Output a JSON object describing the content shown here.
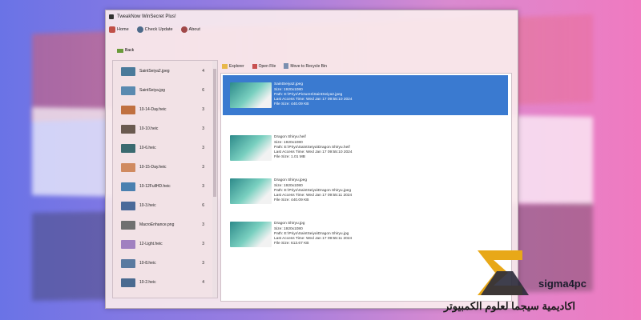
{
  "window": {
    "title": "TweakNow WinSecret Plus!"
  },
  "menu": [
    {
      "label": "Home",
      "icon": "home-icon"
    },
    {
      "label": "Check Update",
      "icon": "globe-icon"
    },
    {
      "label": "About",
      "icon": "info-icon"
    }
  ],
  "back_label": "Back",
  "sidebar": {
    "items": [
      {
        "name": "SaintSeiya2.jpeg",
        "count": "4",
        "thumb": "#4a7a9a"
      },
      {
        "name": "SaintSeiya.jpg",
        "count": "6",
        "thumb": "#5a8ab0"
      },
      {
        "name": "10-14-Day.heic",
        "count": "3",
        "thumb": "#c07040"
      },
      {
        "name": "10-10.heic",
        "count": "3",
        "thumb": "#6a5a50"
      },
      {
        "name": "10-6.heic",
        "count": "3",
        "thumb": "#3a6a70"
      },
      {
        "name": "10-15-Day.heic",
        "count": "3",
        "thumb": "#d08a60"
      },
      {
        "name": "10-12FullHD.heic",
        "count": "3",
        "thumb": "#4a80b0"
      },
      {
        "name": "10-3.heic",
        "count": "6",
        "thumb": "#4a6a9a"
      },
      {
        "name": "MacroEnhance.png",
        "count": "3",
        "thumb": "#707070"
      },
      {
        "name": "12-Light.heic",
        "count": "3",
        "thumb": "#a080c0"
      },
      {
        "name": "10-8.heic",
        "count": "3",
        "thumb": "#5a7aa0"
      },
      {
        "name": "10-2.heic",
        "count": "4",
        "thumb": "#4a6a90"
      }
    ]
  },
  "toolbar": [
    {
      "label": "Explorer",
      "icon": "folder-icon"
    },
    {
      "label": "Open File",
      "icon": "pen-icon"
    },
    {
      "label": "Move to Recycle Bin",
      "icon": "recycle-icon"
    }
  ],
  "files": [
    {
      "name": "SaintSeiya2.jpeg",
      "size": "Size: 1920x1080",
      "path": "Path: E:\\Priyo\\Pictures\\SaintSeiya2.jpeg",
      "access": "Last Access Time: Wed Jan 17 09:55:10 2024",
      "filesize": "File Size: 440.09 KB"
    },
    {
      "name": "Dragon Shiryu.heif",
      "size": "Size: 1920x1080",
      "path": "Path: E:\\Priyo\\SaintSeiya\\Dragon Shiryu.heif",
      "access": "Last Access Time: Wed Jan 17 09:55:10 2024",
      "filesize": "File Size: 1.01 MB"
    },
    {
      "name": "Dragon Shiryu.jpeg",
      "size": "Size: 1920x1080",
      "path": "Path: E:\\Priyo\\SaintSeiya\\Dragon Shiryu.jpeg",
      "access": "Last Access Time: Wed Jan 17 09:55:11 2024",
      "filesize": "File Size: 440.09 KB"
    },
    {
      "name": "Dragon Shiryu.jpg",
      "size": "Size: 1920x1080",
      "path": "Path: E:\\Priyo\\SaintSeiya\\Dragon Shiryu.jpg",
      "access": "Last Access Time: Wed Jan 17 09:55:11 2024",
      "filesize": "File Size: 613.67 KB"
    }
  ],
  "watermark": {
    "brand": "sigma4pc",
    "arabic": "اكاديمية سيجما لعلوم الكمبيوتر"
  }
}
